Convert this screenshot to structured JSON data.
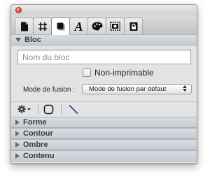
{
  "window": {
    "tabs": [
      {
        "name": "document",
        "icon": "document-icon"
      },
      {
        "name": "canvas",
        "icon": "canvas-frame-icon"
      },
      {
        "name": "style",
        "icon": "shape-style-icon",
        "active": true
      },
      {
        "name": "text",
        "icon": "letter-a-icon",
        "glyph": "A"
      },
      {
        "name": "colors",
        "icon": "palette-icon"
      },
      {
        "name": "image",
        "icon": "image-frame-icon"
      },
      {
        "name": "lock",
        "icon": "lock-icon"
      }
    ]
  },
  "bloc": {
    "title": "Bloc",
    "name_placeholder": "Nom du bloc",
    "name_value": "",
    "non_printable_label": "Non-imprimable",
    "non_printable_checked": false,
    "blend_mode_label": "Mode de fusion :",
    "blend_mode_value": "Mode de fusion par défaut"
  },
  "toolbar": {
    "items": [
      "gear-menu-icon",
      "rounded-square-icon",
      "diagonal-line-icon"
    ]
  },
  "sections": [
    {
      "title": "Forme",
      "expanded": false
    },
    {
      "title": "Contour",
      "expanded": false
    },
    {
      "title": "Ombre",
      "expanded": false
    },
    {
      "title": "Contenu",
      "expanded": false
    }
  ]
}
